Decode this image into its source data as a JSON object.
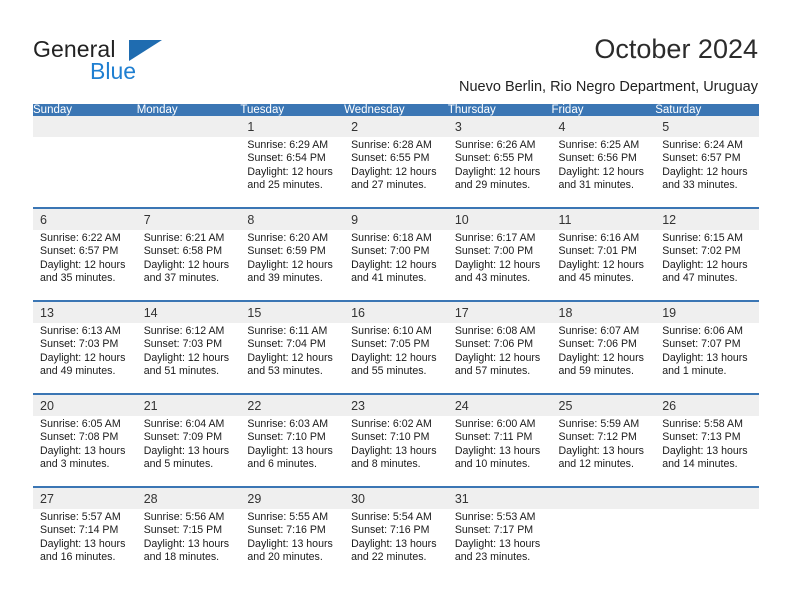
{
  "brand": {
    "word1": "General",
    "word2": "Blue",
    "triangle_color": "#1f6cb0",
    "blue_text_color": "#1f7fd1"
  },
  "header": {
    "title": "October 2024",
    "location": "Nuevo Berlin, Rio Negro Department, Uruguay"
  },
  "theme": {
    "header_bg": "#3b76b4",
    "date_band_bg": "#efefef",
    "cell_bg": "#ffffff",
    "text": "#1a1a1a"
  },
  "weekdays": [
    "Sunday",
    "Monday",
    "Tuesday",
    "Wednesday",
    "Thursday",
    "Friday",
    "Saturday"
  ],
  "weeks": [
    [
      {
        "day": "",
        "lines": []
      },
      {
        "day": "",
        "lines": []
      },
      {
        "day": "1",
        "lines": [
          "Sunrise: 6:29 AM",
          "Sunset: 6:54 PM",
          "Daylight: 12 hours",
          "and 25 minutes."
        ]
      },
      {
        "day": "2",
        "lines": [
          "Sunrise: 6:28 AM",
          "Sunset: 6:55 PM",
          "Daylight: 12 hours",
          "and 27 minutes."
        ]
      },
      {
        "day": "3",
        "lines": [
          "Sunrise: 6:26 AM",
          "Sunset: 6:55 PM",
          "Daylight: 12 hours",
          "and 29 minutes."
        ]
      },
      {
        "day": "4",
        "lines": [
          "Sunrise: 6:25 AM",
          "Sunset: 6:56 PM",
          "Daylight: 12 hours",
          "and 31 minutes."
        ]
      },
      {
        "day": "5",
        "lines": [
          "Sunrise: 6:24 AM",
          "Sunset: 6:57 PM",
          "Daylight: 12 hours",
          "and 33 minutes."
        ]
      }
    ],
    [
      {
        "day": "6",
        "lines": [
          "Sunrise: 6:22 AM",
          "Sunset: 6:57 PM",
          "Daylight: 12 hours",
          "and 35 minutes."
        ]
      },
      {
        "day": "7",
        "lines": [
          "Sunrise: 6:21 AM",
          "Sunset: 6:58 PM",
          "Daylight: 12 hours",
          "and 37 minutes."
        ]
      },
      {
        "day": "8",
        "lines": [
          "Sunrise: 6:20 AM",
          "Sunset: 6:59 PM",
          "Daylight: 12 hours",
          "and 39 minutes."
        ]
      },
      {
        "day": "9",
        "lines": [
          "Sunrise: 6:18 AM",
          "Sunset: 7:00 PM",
          "Daylight: 12 hours",
          "and 41 minutes."
        ]
      },
      {
        "day": "10",
        "lines": [
          "Sunrise: 6:17 AM",
          "Sunset: 7:00 PM",
          "Daylight: 12 hours",
          "and 43 minutes."
        ]
      },
      {
        "day": "11",
        "lines": [
          "Sunrise: 6:16 AM",
          "Sunset: 7:01 PM",
          "Daylight: 12 hours",
          "and 45 minutes."
        ]
      },
      {
        "day": "12",
        "lines": [
          "Sunrise: 6:15 AM",
          "Sunset: 7:02 PM",
          "Daylight: 12 hours",
          "and 47 minutes."
        ]
      }
    ],
    [
      {
        "day": "13",
        "lines": [
          "Sunrise: 6:13 AM",
          "Sunset: 7:03 PM",
          "Daylight: 12 hours",
          "and 49 minutes."
        ]
      },
      {
        "day": "14",
        "lines": [
          "Sunrise: 6:12 AM",
          "Sunset: 7:03 PM",
          "Daylight: 12 hours",
          "and 51 minutes."
        ]
      },
      {
        "day": "15",
        "lines": [
          "Sunrise: 6:11 AM",
          "Sunset: 7:04 PM",
          "Daylight: 12 hours",
          "and 53 minutes."
        ]
      },
      {
        "day": "16",
        "lines": [
          "Sunrise: 6:10 AM",
          "Sunset: 7:05 PM",
          "Daylight: 12 hours",
          "and 55 minutes."
        ]
      },
      {
        "day": "17",
        "lines": [
          "Sunrise: 6:08 AM",
          "Sunset: 7:06 PM",
          "Daylight: 12 hours",
          "and 57 minutes."
        ]
      },
      {
        "day": "18",
        "lines": [
          "Sunrise: 6:07 AM",
          "Sunset: 7:06 PM",
          "Daylight: 12 hours",
          "and 59 minutes."
        ]
      },
      {
        "day": "19",
        "lines": [
          "Sunrise: 6:06 AM",
          "Sunset: 7:07 PM",
          "Daylight: 13 hours",
          "and 1 minute."
        ]
      }
    ],
    [
      {
        "day": "20",
        "lines": [
          "Sunrise: 6:05 AM",
          "Sunset: 7:08 PM",
          "Daylight: 13 hours",
          "and 3 minutes."
        ]
      },
      {
        "day": "21",
        "lines": [
          "Sunrise: 6:04 AM",
          "Sunset: 7:09 PM",
          "Daylight: 13 hours",
          "and 5 minutes."
        ]
      },
      {
        "day": "22",
        "lines": [
          "Sunrise: 6:03 AM",
          "Sunset: 7:10 PM",
          "Daylight: 13 hours",
          "and 6 minutes."
        ]
      },
      {
        "day": "23",
        "lines": [
          "Sunrise: 6:02 AM",
          "Sunset: 7:10 PM",
          "Daylight: 13 hours",
          "and 8 minutes."
        ]
      },
      {
        "day": "24",
        "lines": [
          "Sunrise: 6:00 AM",
          "Sunset: 7:11 PM",
          "Daylight: 13 hours",
          "and 10 minutes."
        ]
      },
      {
        "day": "25",
        "lines": [
          "Sunrise: 5:59 AM",
          "Sunset: 7:12 PM",
          "Daylight: 13 hours",
          "and 12 minutes."
        ]
      },
      {
        "day": "26",
        "lines": [
          "Sunrise: 5:58 AM",
          "Sunset: 7:13 PM",
          "Daylight: 13 hours",
          "and 14 minutes."
        ]
      }
    ],
    [
      {
        "day": "27",
        "lines": [
          "Sunrise: 5:57 AM",
          "Sunset: 7:14 PM",
          "Daylight: 13 hours",
          "and 16 minutes."
        ]
      },
      {
        "day": "28",
        "lines": [
          "Sunrise: 5:56 AM",
          "Sunset: 7:15 PM",
          "Daylight: 13 hours",
          "and 18 minutes."
        ]
      },
      {
        "day": "29",
        "lines": [
          "Sunrise: 5:55 AM",
          "Sunset: 7:16 PM",
          "Daylight: 13 hours",
          "and 20 minutes."
        ]
      },
      {
        "day": "30",
        "lines": [
          "Sunrise: 5:54 AM",
          "Sunset: 7:16 PM",
          "Daylight: 13 hours",
          "and 22 minutes."
        ]
      },
      {
        "day": "31",
        "lines": [
          "Sunrise: 5:53 AM",
          "Sunset: 7:17 PM",
          "Daylight: 13 hours",
          "and 23 minutes."
        ]
      },
      {
        "day": "",
        "lines": []
      },
      {
        "day": "",
        "lines": []
      }
    ]
  ]
}
